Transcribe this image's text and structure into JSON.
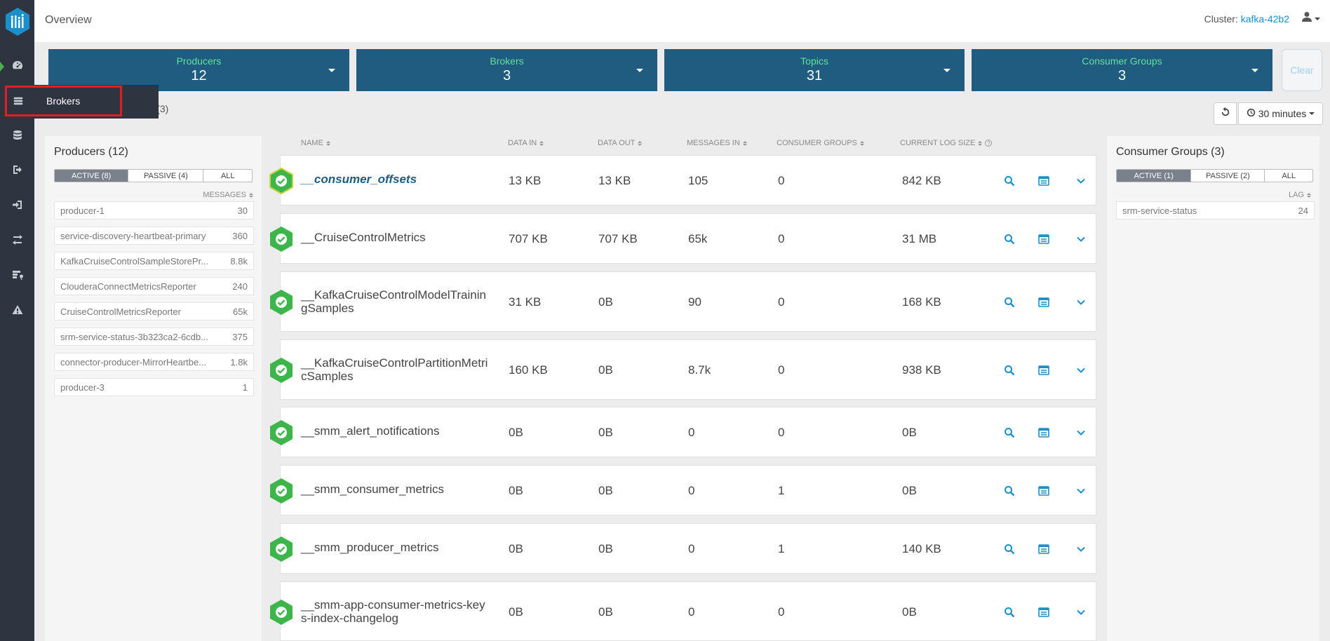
{
  "header": {
    "title": "Overview",
    "cluster_label": "Cluster:",
    "cluster_name": "kafka-42b2"
  },
  "sidebar": {
    "items": [
      {
        "icon": "dashboard-icon"
      },
      {
        "icon": "brokers-icon"
      },
      {
        "icon": "database-icon"
      },
      {
        "icon": "producer-icon"
      },
      {
        "icon": "consumer-icon"
      },
      {
        "icon": "replication-icon"
      },
      {
        "icon": "data-explorer-icon"
      },
      {
        "icon": "alerts-icon"
      }
    ],
    "tooltip_label": "Brokers"
  },
  "summary": [
    {
      "label": "Producers",
      "count": "12"
    },
    {
      "label": "Brokers",
      "count": "3"
    },
    {
      "label": "Topics",
      "count": "31"
    },
    {
      "label": "Consumer Groups",
      "count": "3"
    }
  ],
  "clear_label": "Clear",
  "tab_partial_text": "S (3)",
  "time_range": "30 minutes",
  "producers_panel": {
    "title": "Producers (12)",
    "filters": [
      "ACTIVE (8)",
      "PASSIVE (4)",
      "ALL"
    ],
    "column": "MESSAGES",
    "items": [
      {
        "name": "producer-1",
        "value": "30"
      },
      {
        "name": "service-discovery-heartbeat-primary",
        "value": "360"
      },
      {
        "name": "KafkaCruiseControlSampleStorePr...",
        "value": "8.8k"
      },
      {
        "name": "ClouderaConnectMetricsReporter",
        "value": "240"
      },
      {
        "name": "CruiseControlMetricsReporter",
        "value": "65k"
      },
      {
        "name": "srm-service-status-3b323ca2-6cdb...",
        "value": "375"
      },
      {
        "name": "connector-producer-MirrorHeartbe...",
        "value": "1.8k"
      },
      {
        "name": "producer-3",
        "value": "1"
      }
    ]
  },
  "consumer_panel": {
    "title": "Consumer Groups (3)",
    "filters": [
      "ACTIVE (1)",
      "PASSIVE (2)",
      "ALL"
    ],
    "column": "LAG",
    "items": [
      {
        "name": "srm-service-status",
        "value": "24"
      }
    ]
  },
  "topics_table": {
    "columns": [
      "NAME",
      "DATA IN",
      "DATA OUT",
      "MESSAGES IN",
      "CONSUMER GROUPS",
      "CURRENT LOG SIZE"
    ],
    "rows": [
      {
        "name": "__consumer_offsets",
        "data_in": "13 KB",
        "data_out": "13 KB",
        "messages_in": "105",
        "consumer_groups": "0",
        "log_size": "842 KB"
      },
      {
        "name": "__CruiseControlMetrics",
        "data_in": "707 KB",
        "data_out": "707 KB",
        "messages_in": "65k",
        "consumer_groups": "0",
        "log_size": "31 MB"
      },
      {
        "name": "__KafkaCruiseControlModelTrainingSamples",
        "data_in": "31 KB",
        "data_out": "0B",
        "messages_in": "90",
        "consumer_groups": "0",
        "log_size": "168 KB"
      },
      {
        "name": "__KafkaCruiseControlPartitionMetricSamples",
        "data_in": "160 KB",
        "data_out": "0B",
        "messages_in": "8.7k",
        "consumer_groups": "0",
        "log_size": "938 KB"
      },
      {
        "name": "__smm_alert_notifications",
        "data_in": "0B",
        "data_out": "0B",
        "messages_in": "0",
        "consumer_groups": "0",
        "log_size": "0B"
      },
      {
        "name": "__smm_consumer_metrics",
        "data_in": "0B",
        "data_out": "0B",
        "messages_in": "0",
        "consumer_groups": "1",
        "log_size": "0B"
      },
      {
        "name": "__smm_producer_metrics",
        "data_in": "0B",
        "data_out": "0B",
        "messages_in": "0",
        "consumer_groups": "1",
        "log_size": "140 KB"
      },
      {
        "name": "__smm-app-consumer-metrics-keys-index-changelog",
        "data_in": "0B",
        "data_out": "0B",
        "messages_in": "0",
        "consumer_groups": "0",
        "log_size": "0B"
      }
    ]
  },
  "colors": {
    "sidebar": "#2e3540",
    "card": "#1f5c80",
    "card_label": "#5fe39a",
    "accent": "#1a8fc9",
    "status_ok": "#3cb54a"
  }
}
